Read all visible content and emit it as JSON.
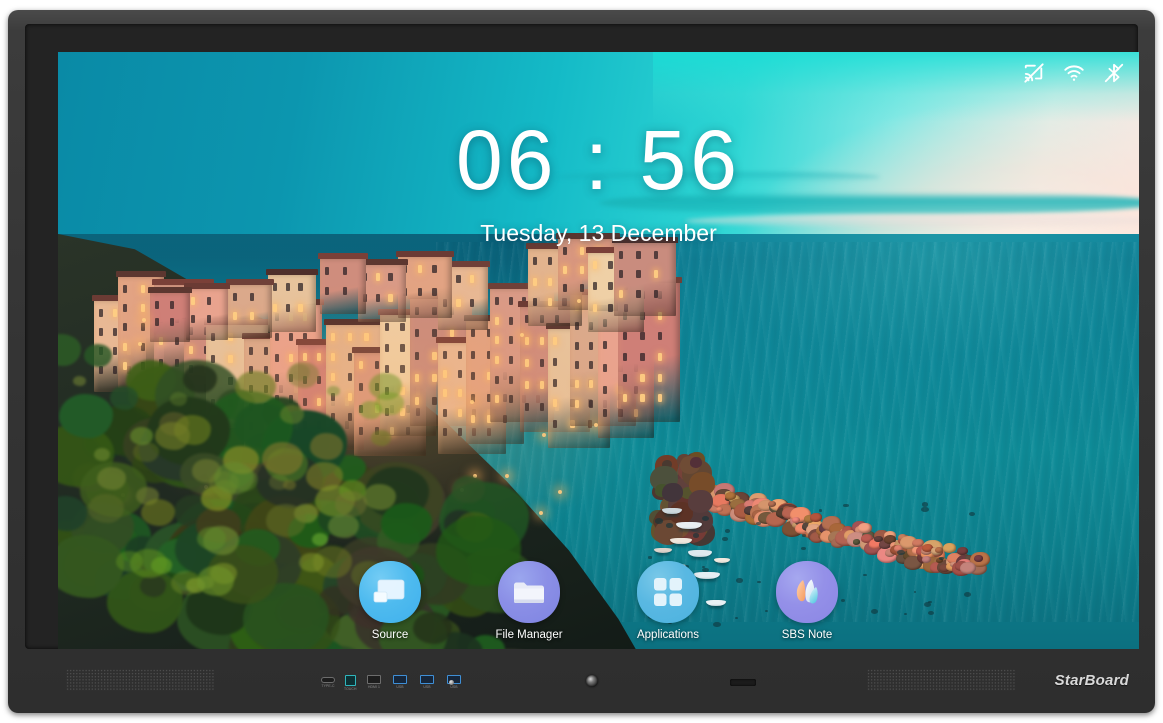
{
  "device": {
    "brand": "StarBoard",
    "bezel_color": "#343434",
    "ports": [
      {
        "label": "TYPE-C",
        "type": "usb-c"
      },
      {
        "label": "TOUCH",
        "type": "usb-b"
      },
      {
        "label": "HDMI 1",
        "type": "hdmi"
      },
      {
        "label": "USB",
        "type": "usb-a"
      },
      {
        "label": "USB",
        "type": "usb-a"
      },
      {
        "label": "USB",
        "type": "usb-a"
      }
    ],
    "hardware": {
      "speaker_left": "speaker-grille-left",
      "speaker_right": "speaker-grille-right",
      "power_led": "power-led",
      "light_sensor": "light-sensor",
      "ir_receiver": "ir-receiver-window"
    }
  },
  "screen": {
    "statusbar": {
      "icons": [
        {
          "name": "cast-off-icon",
          "label": "Screen cast disabled",
          "state": "off"
        },
        {
          "name": "wifi-icon",
          "label": "Wi-Fi connected",
          "state": "on"
        },
        {
          "name": "bluetooth-off-icon",
          "label": "Bluetooth disabled",
          "state": "off"
        }
      ],
      "icon_color": "#ffffff"
    },
    "clock": {
      "hours": "06",
      "separator": ":",
      "minutes": "56",
      "time": "06 : 56",
      "date": "Tuesday, 13 December"
    },
    "dock": {
      "items": [
        {
          "label": "Source",
          "icon": "display-screen-icon",
          "accent": "#4fbbef"
        },
        {
          "label": "File Manager",
          "icon": "folder-icon",
          "accent": "#8b8fe6"
        },
        {
          "label": "Applications",
          "icon": "grid-apps-icon",
          "accent": "#59b8e2"
        },
        {
          "label": "SBS Note",
          "icon": "butterfly-wing-icon",
          "accent": "#9490e8"
        }
      ]
    },
    "wallpaper": {
      "name": "coastal-village-at-dusk",
      "sky_color": "#0a8aa6",
      "sea_color": "#0e7d96",
      "sunset_color": "#f7e8e2"
    }
  }
}
